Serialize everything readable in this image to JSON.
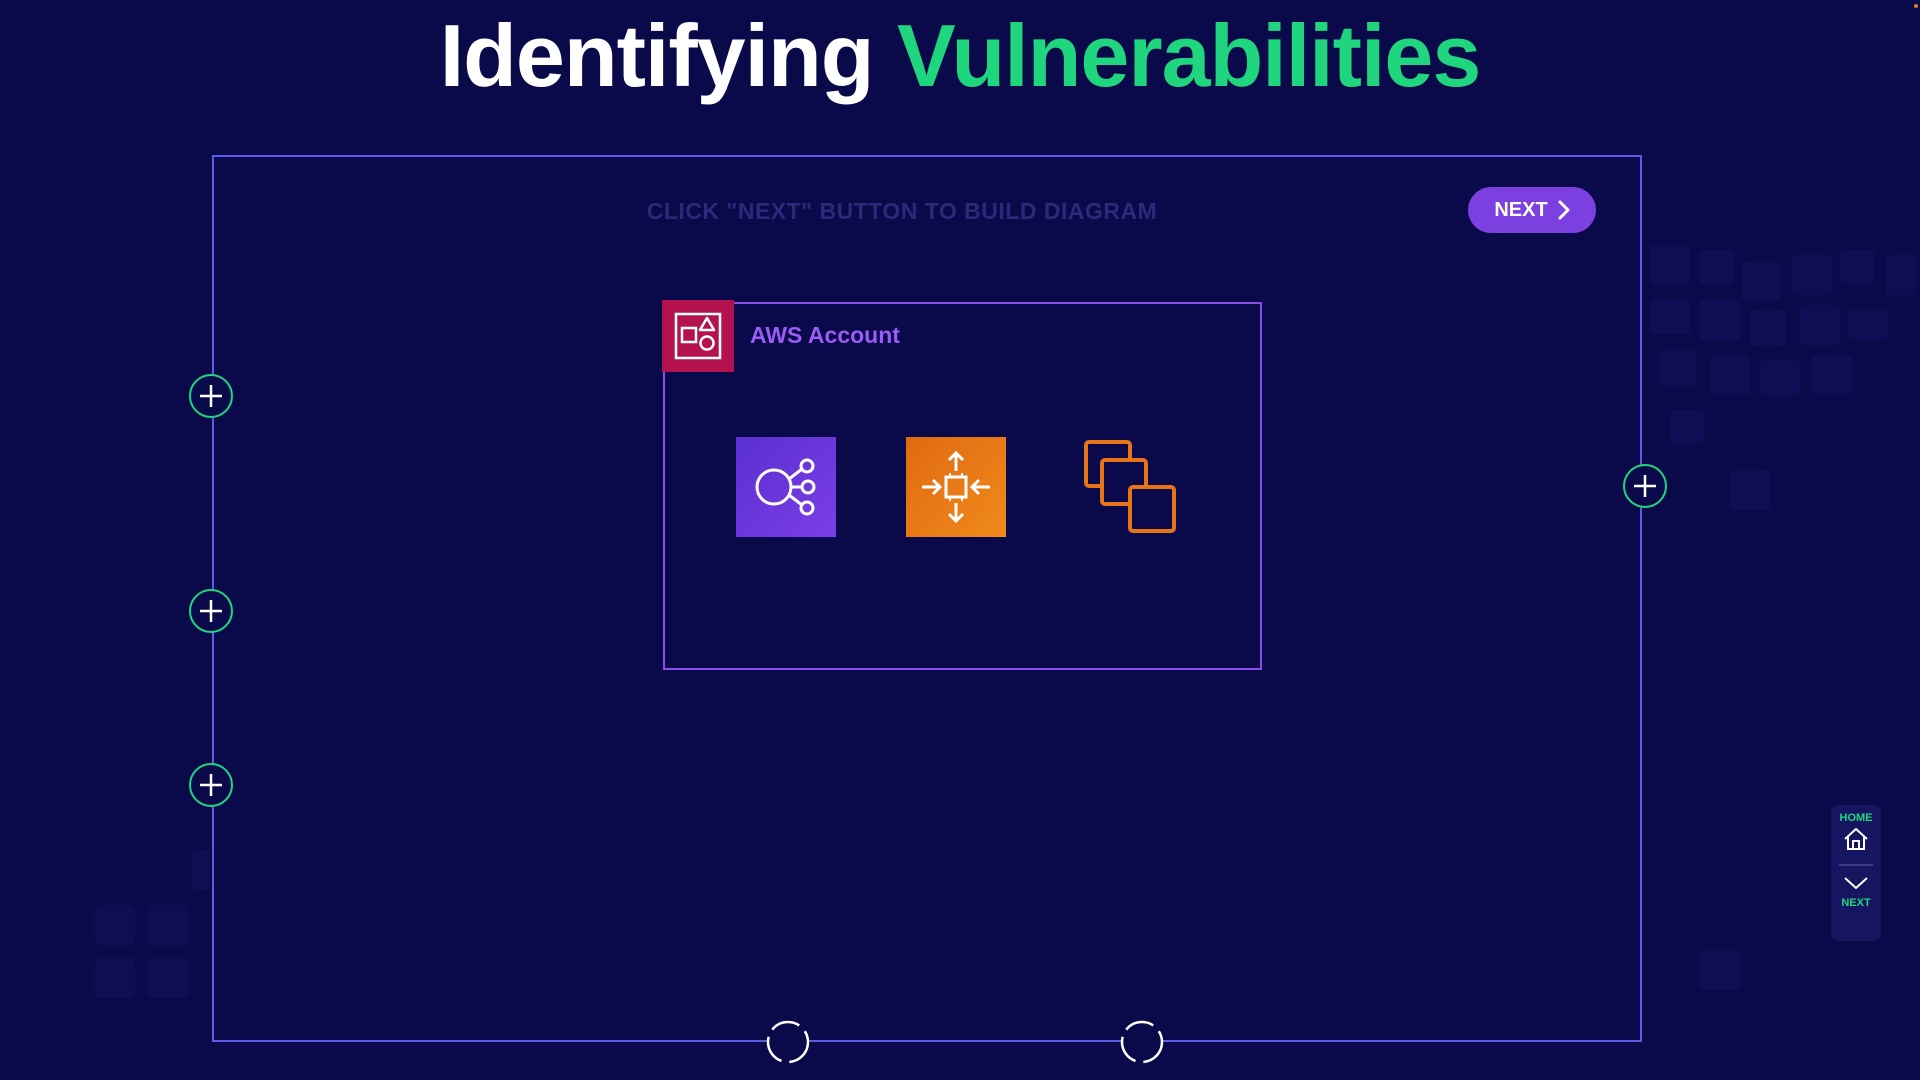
{
  "title": {
    "part1": "Identifying",
    "part2": "Vulnerabilities"
  },
  "diagram": {
    "instruction": "CLICK \"NEXT\" BUTTON TO BUILD DIAGRAM",
    "next_button_label": "NEXT",
    "aws_account": {
      "label": "AWS Account",
      "icon": "aws-account-group-icon"
    },
    "services": [
      {
        "icon": "network-hub-icon"
      },
      {
        "icon": "compute-chip-icon"
      },
      {
        "icon": "multiple-instances-icon"
      }
    ]
  },
  "side_nav": {
    "home_label": "HOME",
    "next_label": "NEXT"
  },
  "colors": {
    "background": "#0a0a4a",
    "accent_green": "#1fd67e",
    "accent_purple": "#7c3fe0",
    "frame_border": "#5b5be6",
    "account_icon": "#b3124f",
    "compute_orange": "#e8741a"
  }
}
